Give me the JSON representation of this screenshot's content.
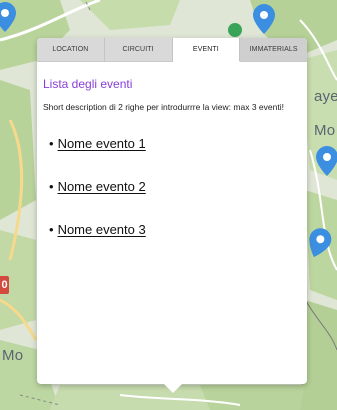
{
  "map": {
    "labels": [
      "aye",
      "Mo",
      "Mo"
    ],
    "route_badge": "0",
    "colors": {
      "land": "#dfe6d5",
      "forest": "#b9d49b",
      "road": "#f6d98b",
      "pin": "#3c8fe0"
    }
  },
  "popup": {
    "tabs": [
      {
        "label": "LOCATION",
        "active": false
      },
      {
        "label": "CIRCUITI",
        "active": false
      },
      {
        "label": "EVENTI",
        "active": true
      },
      {
        "label": "IMMATERIALS",
        "active": false
      }
    ],
    "title": "Lista degli eventi",
    "description": "Short description di 2 righe per introdurrre la view: max 3 eventi!",
    "events": [
      {
        "label": "Nome evento 1"
      },
      {
        "label": "Nome evento 2"
      },
      {
        "label": "Nome evento 3"
      }
    ],
    "bullet": "•",
    "colors": {
      "title": "#8a3fd6",
      "tab_bg": "#d9d9d9",
      "tab_active_bg": "#ffffff"
    }
  }
}
